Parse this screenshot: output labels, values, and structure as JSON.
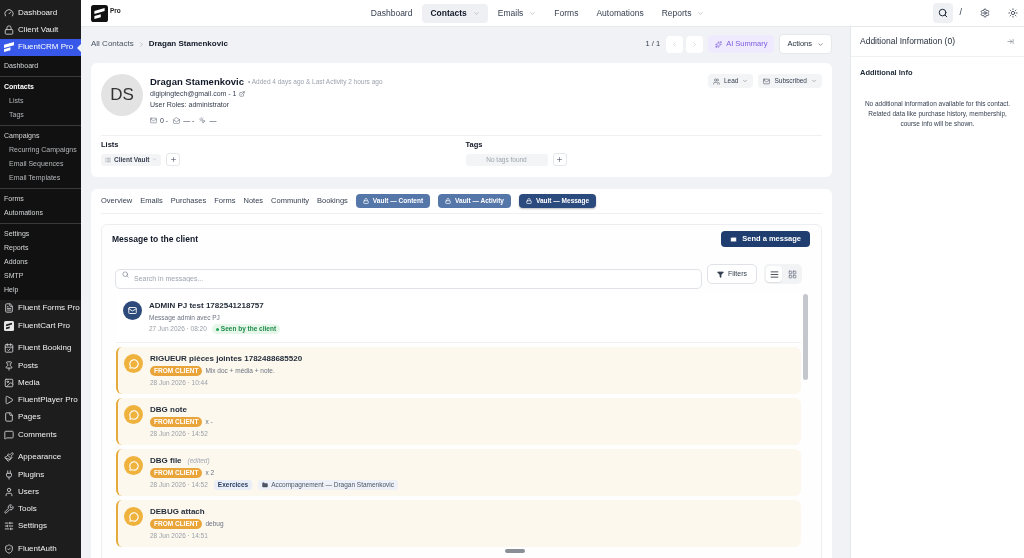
{
  "admin_menu": [
    {
      "items": [
        {
          "label": "Dashboard",
          "selected": false
        },
        {
          "label": "Client Vault",
          "selected": false
        },
        {
          "label": "FluentCRM Pro",
          "selected": true,
          "submenu_groups": [
            {
              "items": [
                {
                  "label": "Dashboard",
                  "selected": false
                }
              ]
            },
            {
              "items": [
                {
                  "label": "Contacts",
                  "selected": true,
                  "children": [
                    {
                      "label": "Lists",
                      "selected": false
                    },
                    {
                      "label": "Tags",
                      "selected": false
                    }
                  ]
                }
              ]
            },
            {
              "items": [
                {
                  "label": "Campaigns",
                  "selected": false,
                  "children": [
                    {
                      "label": "Recurring Campaigns",
                      "selected": false
                    },
                    {
                      "label": "Email Sequences",
                      "selected": false
                    },
                    {
                      "label": "Email Templates",
                      "selected": false
                    }
                  ]
                }
              ]
            },
            {
              "items": [
                {
                  "label": "Forms",
                  "selected": false
                },
                {
                  "label": "Automations",
                  "selected": false
                }
              ]
            },
            {
              "items": [
                {
                  "label": "Settings",
                  "selected": false
                },
                {
                  "label": "Reports",
                  "selected": false
                },
                {
                  "label": "Addons",
                  "selected": false
                },
                {
                  "label": "SMTP",
                  "selected": false
                },
                {
                  "label": "Help",
                  "selected": false
                }
              ]
            }
          ]
        },
        {
          "label": "Fluent Forms Pro",
          "selected": false
        },
        {
          "label": "FluentCart Pro",
          "selected": false
        }
      ]
    },
    {
      "items": [
        {
          "label": "Fluent Booking",
          "selected": false
        },
        {
          "label": "Posts",
          "selected": false
        },
        {
          "label": "Media",
          "selected": false
        },
        {
          "label": "FluentPlayer Pro",
          "selected": false
        },
        {
          "label": "Pages",
          "selected": false
        },
        {
          "label": "Comments",
          "selected": false
        }
      ]
    },
    {
      "items": [
        {
          "label": "Appearance",
          "selected": false
        },
        {
          "label": "Plugins",
          "selected": false
        },
        {
          "label": "Users",
          "selected": false
        },
        {
          "label": "Tools",
          "selected": false
        },
        {
          "label": "Settings",
          "selected": false
        }
      ]
    },
    {
      "items": [
        {
          "label": "FluentAuth",
          "selected": false
        }
      ]
    }
  ],
  "top_nav": {
    "brand": "Pro",
    "items": [
      {
        "label": "Dashboard",
        "selected": false,
        "dropdown": false
      },
      {
        "label": "Contacts",
        "selected": true,
        "dropdown": true
      },
      {
        "label": "Emails",
        "selected": false,
        "dropdown": true
      },
      {
        "label": "Forms",
        "selected": false,
        "dropdown": false
      },
      {
        "label": "Automations",
        "selected": false,
        "dropdown": false
      },
      {
        "label": "Reports",
        "selected": false,
        "dropdown": true
      }
    ],
    "shortcut": "/"
  },
  "breadcrumb": [
    "All Contacts",
    "Dragan Stamenkovic"
  ],
  "toolbar": {
    "pager": "1 / 1",
    "ai_button": "AI Summary",
    "actions_button": "Actions"
  },
  "contact": {
    "initials": "DS",
    "name": "Dragan Stamenkovic",
    "meta": "• Added 4 days ago & Last Activity 2 hours ago",
    "email": "digipingtech@gmail.com - 1",
    "roles": "User Roles: administrator",
    "stats": [
      {
        "kind": "sent",
        "value": "0 -"
      },
      {
        "kind": "opened",
        "value": "— -"
      },
      {
        "kind": "clicked",
        "value": "—"
      }
    ],
    "status_menus": [
      {
        "kind": "type",
        "label": "Lead"
      },
      {
        "kind": "subscription",
        "label": "Subscribed"
      }
    ],
    "lists": {
      "heading": "Lists",
      "items": [
        "Client Vault"
      ]
    },
    "tags": {
      "heading": "Tags",
      "empty": "No tags found"
    }
  },
  "profile_tabs": [
    {
      "label": "Overview",
      "kind": "plain",
      "selected": false
    },
    {
      "label": "Emails",
      "kind": "plain",
      "selected": false
    },
    {
      "label": "Purchases",
      "kind": "plain",
      "selected": false
    },
    {
      "label": "Forms",
      "kind": "plain",
      "selected": false
    },
    {
      "label": "Notes",
      "kind": "plain",
      "selected": false
    },
    {
      "label": "Community",
      "kind": "plain",
      "selected": false
    },
    {
      "label": "Bookings",
      "kind": "plain",
      "selected": false
    },
    {
      "label": "Vault — Content",
      "kind": "vault",
      "selected": false
    },
    {
      "label": "Vault — Activity",
      "kind": "vault",
      "selected": false
    },
    {
      "label": "Vault — Message",
      "kind": "vault",
      "selected": true
    }
  ],
  "messages_panel": {
    "title": "Message to the client",
    "send_button": "Send a message",
    "search": {
      "placeholder": "Search in messages..."
    },
    "filters_button": "Filters",
    "view_modes": [
      {
        "kind": "list",
        "selected": true
      },
      {
        "kind": "grid",
        "selected": false
      }
    ],
    "messages": [
      {
        "kind": "admin",
        "title": "ADMIN PJ test 1782541218757",
        "body": "Message admin avec PJ",
        "time": "27 Jun 2026 · 08:20",
        "status": "Seen by the client"
      },
      {
        "kind": "client",
        "title": "RIGUEUR pièces jointes 1782488685520",
        "badge": "FROM CLIENT",
        "body": "Mix doc + média + note.",
        "time": "28 Jun 2026 · 10:44"
      },
      {
        "kind": "client",
        "title": "DBG note",
        "badge": "FROM CLIENT",
        "body": "x -",
        "time": "28 Jun 2026 · 14:52"
      },
      {
        "kind": "client",
        "title": "DBG file",
        "edited": "(edited)",
        "badge": "FROM CLIENT",
        "body": "x 2",
        "time": "28 Jun 2026 · 14:52",
        "tags": [
          {
            "kind": "tag",
            "label": "Exercices"
          },
          {
            "kind": "folder",
            "label": "Accompagnement — Dragan Stamenkovic"
          }
        ]
      },
      {
        "kind": "client",
        "title": "DEBUG attach",
        "badge": "FROM CLIENT",
        "body": "debug",
        "time": "28 Jun 2026 · 14:51"
      }
    ]
  },
  "right_panel": {
    "title": "Additional Information (0)",
    "section": "Additional Info",
    "empty_text": "No additional information available for this contact. Related data like purchase history, membership, course info will be shown."
  }
}
